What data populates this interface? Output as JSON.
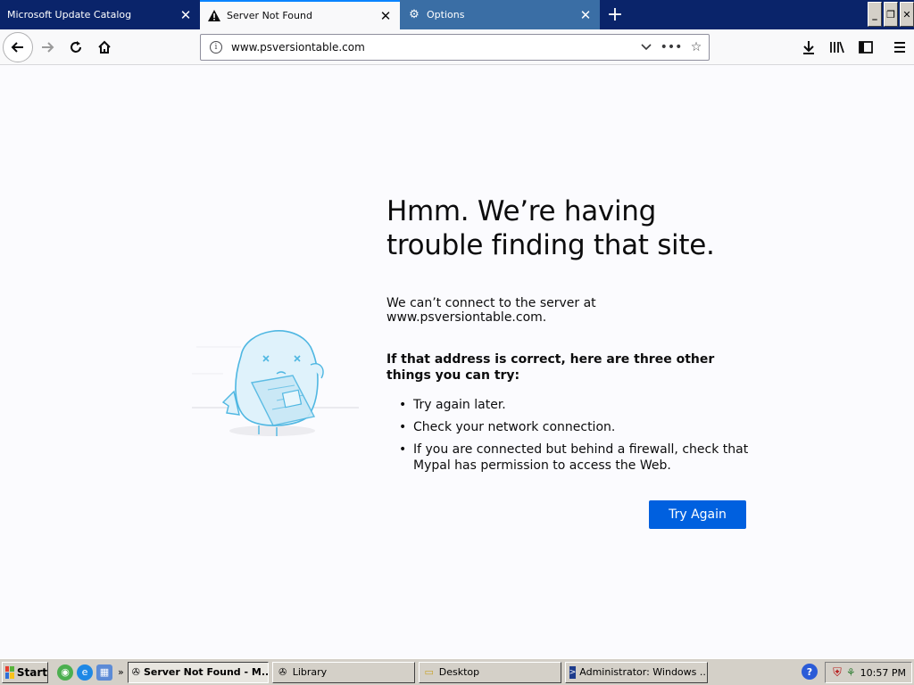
{
  "tabs": [
    {
      "label": "Microsoft Update Catalog"
    },
    {
      "label": "Server Not Found"
    },
    {
      "label": "Options"
    }
  ],
  "urlbar": {
    "value": "www.psversiontable.com"
  },
  "error": {
    "title": "Hmm. We’re having trouble finding that site.",
    "description": "We can’t connect to the server at www.psversiontable.com.",
    "subheading": "If that address is correct, here are three other things you can try:",
    "suggestions": [
      "Try again later.",
      "Check your network connection.",
      "If you are connected but behind a firewall, check that Mypal has permission to access the Web."
    ],
    "button_label": "Try Again"
  },
  "taskbar": {
    "start_label": "Start",
    "items": [
      {
        "label": "Server Not Found - M..."
      },
      {
        "label": "Library"
      },
      {
        "label": "Desktop"
      },
      {
        "label": "Administrator: Windows ..."
      }
    ],
    "clock": "10:57 PM"
  },
  "colors": {
    "accent": "#0060df",
    "tab_highlight": "#0a84ff",
    "titlebar": "#0a246a"
  }
}
